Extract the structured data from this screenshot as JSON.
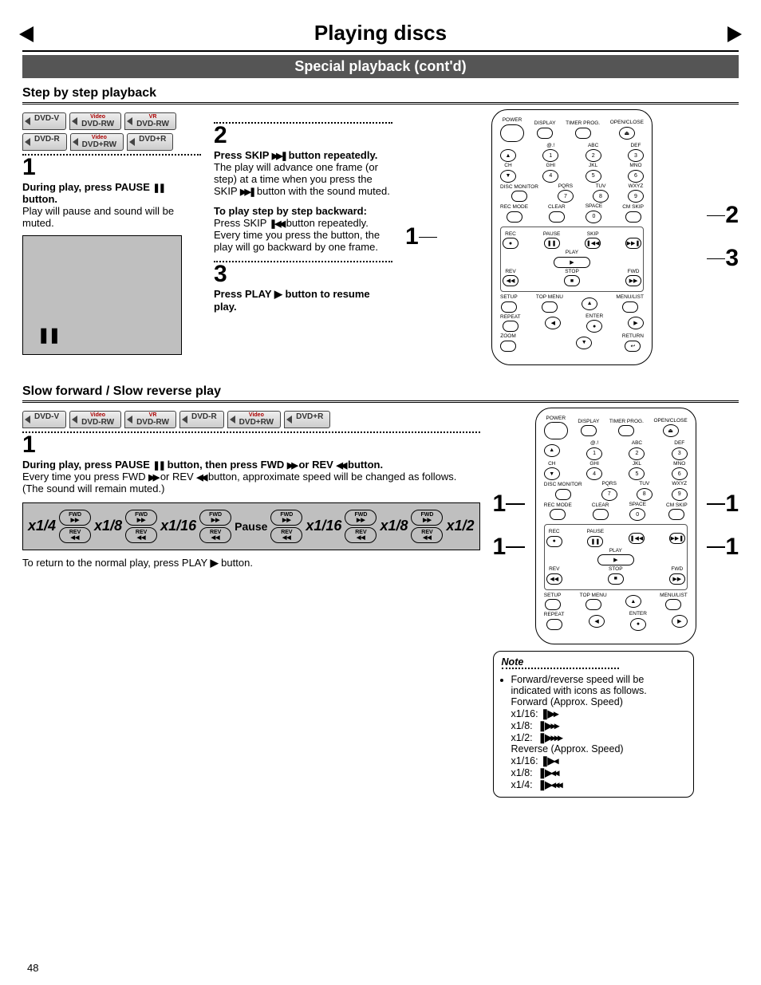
{
  "page_number": "48",
  "title": "Playing discs",
  "subtitle": "Special playback (cont'd)",
  "section1": {
    "heading": "Step by step playback",
    "badges": [
      "DVD-V",
      "DVD-RW Video",
      "DVD-RW VR",
      "DVD-R",
      "DVD+RW Video",
      "DVD+R"
    ],
    "step1": {
      "num": "1",
      "bold": "During play, press PAUSE ❚❚ button.",
      "text": "Play will pause and sound will be muted."
    },
    "step2": {
      "num": "2",
      "bold": "Press SKIP ▶▶❚ button repeatedly.",
      "text": "The play will advance one frame (or step) at a time when you press the SKIP ▶▶❚ button with the sound muted.",
      "sub_bold": "To play step by step backward:",
      "sub_text": "Press SKIP ❚◀◀ button repeatedly. Every time you press the button, the play will go backward by one frame."
    },
    "step3": {
      "num": "3",
      "bold": "Press PLAY ▶ button to resume play."
    },
    "remote_callouts": {
      "left": [
        "1"
      ],
      "right": [
        "2",
        "3"
      ]
    }
  },
  "section2": {
    "heading": "Slow forward / Slow reverse play",
    "badges": [
      "DVD-V",
      "DVD-RW Video",
      "DVD-RW VR",
      "DVD-R",
      "DVD+RW Video",
      "DVD+R"
    ],
    "step1": {
      "num": "1",
      "bold": "During play, press PAUSE ❚❚ button, then press FWD ▶▶ or REV ◀◀ button.",
      "text": "Every time you press FWD ▶▶ or REV ◀◀ button, approximate speed will be changed as follows. (The sound will remain muted.)"
    },
    "speeds_left": [
      "x1/4",
      "x1/8",
      "x1/16"
    ],
    "pause_label": "Pause",
    "speeds_right": [
      "x1/16",
      "x1/8",
      "x1/2"
    ],
    "resume": "To return to the normal play, press PLAY ▶ button.",
    "remote_callouts": {
      "left": [
        "1",
        "1"
      ],
      "right": [
        "1",
        "1"
      ]
    }
  },
  "note": {
    "title": "Note",
    "body": "Forward/reverse speed will be indicated with icons as follows.",
    "fwd_label": "Forward (Approx. Speed)",
    "rev_label": "Reverse (Approx. Speed)",
    "fwd": [
      {
        "s": "x1/16:",
        "i": "❚▶▸"
      },
      {
        "s": "x1/8:",
        "i": "❚▶▸▸"
      },
      {
        "s": "x1/2:",
        "i": "❚▶▸▸▸"
      }
    ],
    "rev": [
      {
        "s": "x1/16:",
        "i": "❚▶◂"
      },
      {
        "s": "x1/8:",
        "i": "❚▶◂◂"
      },
      {
        "s": "x1/4:",
        "i": "❚▶◂◂◂"
      }
    ]
  },
  "remote_labels": {
    "power": "POWER",
    "display": "DISPLAY",
    "timer": "TIMER PROG.",
    "open": "OPEN/CLOSE",
    "ch": "CH",
    "disc_monitor": "DISC MONITOR",
    "recmode": "REC MODE",
    "clear": "CLEAR",
    "space": "SPACE",
    "cmskip": "CM SKIP",
    "rec": "REC",
    "pause": "PAUSE",
    "skip": "SKIP",
    "play": "PLAY",
    "stop": "STOP",
    "rev": "REV",
    "fwd": "FWD",
    "setup": "SETUP",
    "topmenu": "TOP MENU",
    "menulist": "MENU/LIST",
    "repeat": "REPEAT",
    "enter": "ENTER",
    "zoom": "ZOOM",
    "return": "RETURN",
    "n1": "1",
    "n2": "2",
    "n3": "3",
    "n4": "4",
    "n5": "5",
    "n6": "6",
    "n7": "7",
    "n8": "8",
    "n9": "9",
    "n0": "0",
    "l1": "@.!",
    "l2": "ABC",
    "l3": "DEF",
    "l4": "GHI",
    "l5": "JKL",
    "l6": "MNO",
    "l7": "PQRS",
    "l8": "TUV",
    "l9": "WXYZ"
  }
}
